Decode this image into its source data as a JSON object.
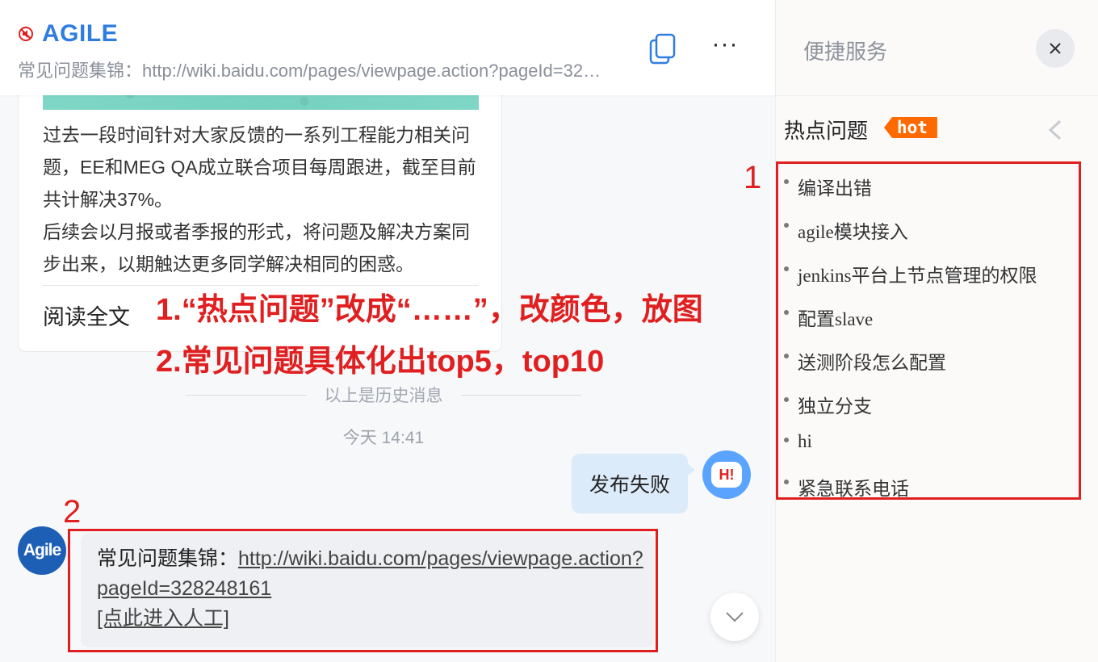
{
  "header": {
    "title": "AGILE",
    "subtitle": "常见问题集锦：http://wiki.baidu.com/pages/viewpage.action?pageId=328248161",
    "copy_icon": "copy-icon",
    "more_label": "···"
  },
  "history_card": {
    "paragraphs": [
      "过去一段时间针对大家反馈的一系列工程能力相关问题，EE和MEG QA成立联合项目每周跟进，截至目前共计解决37%。",
      "后续会以月报或者季报的形式，将问题及解决方案同步出来，以期触达更多同学解决相同的困惑。"
    ],
    "read_all": "阅读全文"
  },
  "annotations": {
    "line1": "1.“热点问题”改成“……”，改颜色，放图",
    "line2": "2.常见问题具体化出top5，top10",
    "marker_1": "1",
    "marker_2": "2",
    "color": "#e02020"
  },
  "history_separator": "以上是历史消息",
  "timestamp": "今天 14:41",
  "my_message": {
    "text": "发布失败",
    "avatar_text": "H!"
  },
  "bot_message": {
    "avatar_text": "Agile",
    "prefix": "常见问题集锦：",
    "link": "http://wiki.baidu.com/pages/viewpage.action?pageId=328248161",
    "action": "[点此进入人工]"
  },
  "side_panel": {
    "title": "便捷服务",
    "hot_section_title": "热点问题",
    "hot_badge": "hot",
    "hot_badge_color": "#ff6a00",
    "hot_items": [
      "编译出错",
      "agile模块接入",
      "jenkins平台上节点管理的权限",
      "配置slave",
      "送测阶段怎么配置",
      "独立分支",
      "hi",
      "紧急联系电话"
    ]
  }
}
